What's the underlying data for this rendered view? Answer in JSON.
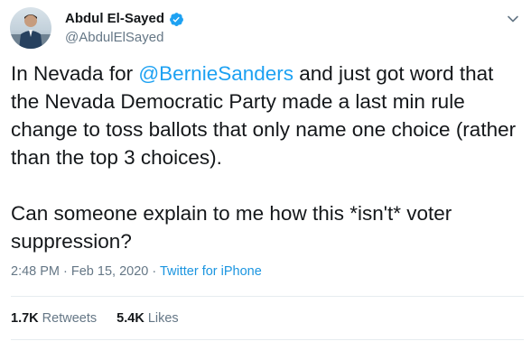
{
  "author": {
    "display_name": "Abdul El-Sayed",
    "handle": "@AbdulElSayed",
    "verified_icon": "verified-badge-icon"
  },
  "tweet": {
    "text_before_mention": "In Nevada for ",
    "mention": "@BernieSanders",
    "text_after_mention": " and just got word that the Nevada Democratic Party made a last min rule change to toss ballots that only name one choice (rather than the top 3 choices).",
    "paragraph2": "Can someone explain to me how this *isn't* voter suppression?"
  },
  "meta": {
    "time": "2:48 PM",
    "date": "Feb 15, 2020",
    "separator": " · ",
    "source": "Twitter for iPhone"
  },
  "stats": {
    "retweets_count": "1.7K",
    "retweets_label": "Retweets",
    "likes_count": "5.4K",
    "likes_label": "Likes"
  },
  "colors": {
    "accent": "#1da1f2",
    "text": "#14171a",
    "muted": "#657786"
  }
}
